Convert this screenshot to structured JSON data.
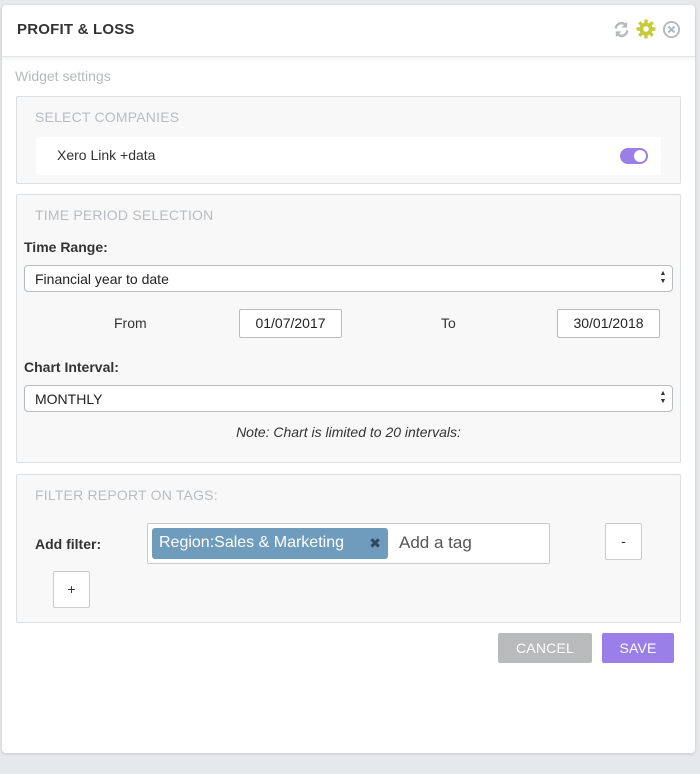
{
  "header": {
    "title": "PROFIT & LOSS",
    "icons": [
      "refresh-icon",
      "gear-icon",
      "close-icon"
    ],
    "icon_colors": {
      "refresh": "#b5b9bd",
      "gear": "#c6cb3a",
      "close": "#b5b9bd"
    }
  },
  "widget_settings_label": "Widget settings",
  "select_companies": {
    "title": "SELECT COMPANIES",
    "companies": [
      {
        "name": "Xero Link +data",
        "enabled": true
      }
    ]
  },
  "time_period": {
    "title": "TIME PERIOD SELECTION",
    "time_range_label": "Time Range:",
    "time_range_value": "Financial year to date",
    "from_label": "From",
    "from_value": "01/07/2017",
    "to_label": "To",
    "to_value": "30/01/2018",
    "chart_interval_label": "Chart Interval:",
    "chart_interval_value": "MONTHLY",
    "note": "Note: Chart is limited to 20 intervals:"
  },
  "filter_tags": {
    "title": "FILTER REPORT ON TAGS:",
    "add_filter_label": "Add filter:",
    "tags": [
      "Region:Sales & Marketing"
    ],
    "tag_remove_glyph": "✖",
    "placeholder": "Add a tag",
    "remove_button_label": "-",
    "add_button_label": "+"
  },
  "actions": {
    "cancel_label": "CANCEL",
    "save_label": "SAVE",
    "cancel_color": "#b8babc",
    "save_color": "#9b7fe8"
  },
  "colors": {
    "accent": "#9b7fe8",
    "tag": "#6f9cbd"
  }
}
